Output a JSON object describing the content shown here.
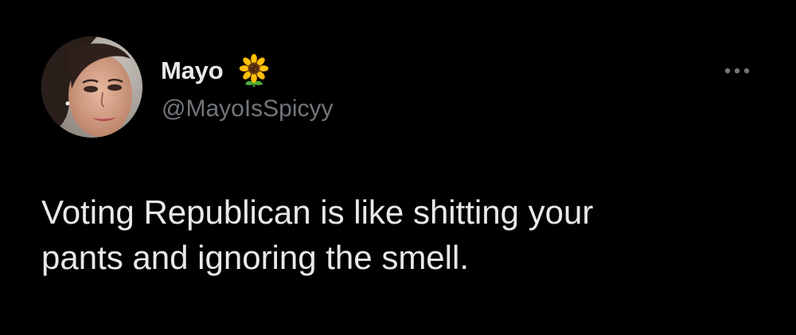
{
  "tweet": {
    "author": {
      "display_name": "Mayo",
      "name_emoji": "sunflower-emoji-icon",
      "handle": "@MayoIsSpicyy"
    },
    "body_lines": [
      "Voting Republican is like shitting your",
      "pants and ignoring the smell."
    ],
    "more_icon": "more-options-icon"
  },
  "theme": {
    "background": "#000000",
    "primary_text": "#e7e9ea",
    "secondary_text": "#71767b"
  }
}
